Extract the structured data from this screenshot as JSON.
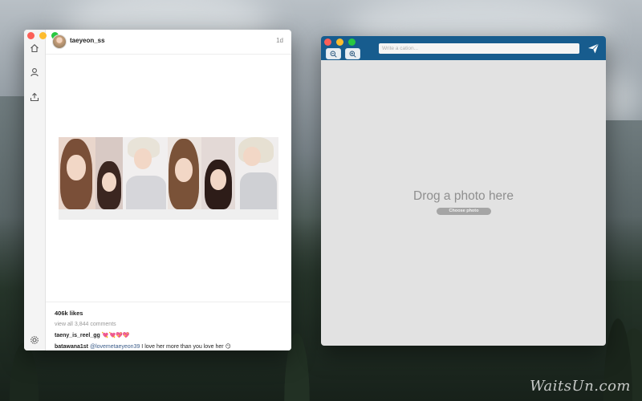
{
  "feed": {
    "username": "taeyeon_ss",
    "time": "1d",
    "likes": "406k likes",
    "view_comments": "view all 3,844 comments",
    "comments": [
      {
        "user": "taeny_is_reel_gg",
        "mention": "",
        "text": "",
        "emoji": "💘💘💖💖"
      },
      {
        "user": "batawana1st",
        "mention": "@lovemetaeyeon39",
        "text": " I love her more than you love her ",
        "emoji": "😏"
      }
    ],
    "nav_icons": [
      "home-icon",
      "profile-icon",
      "upload-icon",
      "settings-icon"
    ]
  },
  "upload": {
    "caption_placeholder": "Write a cation...",
    "drop_text": "Drog a photo here",
    "choose_label": "Choose photo",
    "toolbar_color": "#175c8e"
  },
  "desktop": {
    "watermark": "WaitsUn.com"
  }
}
